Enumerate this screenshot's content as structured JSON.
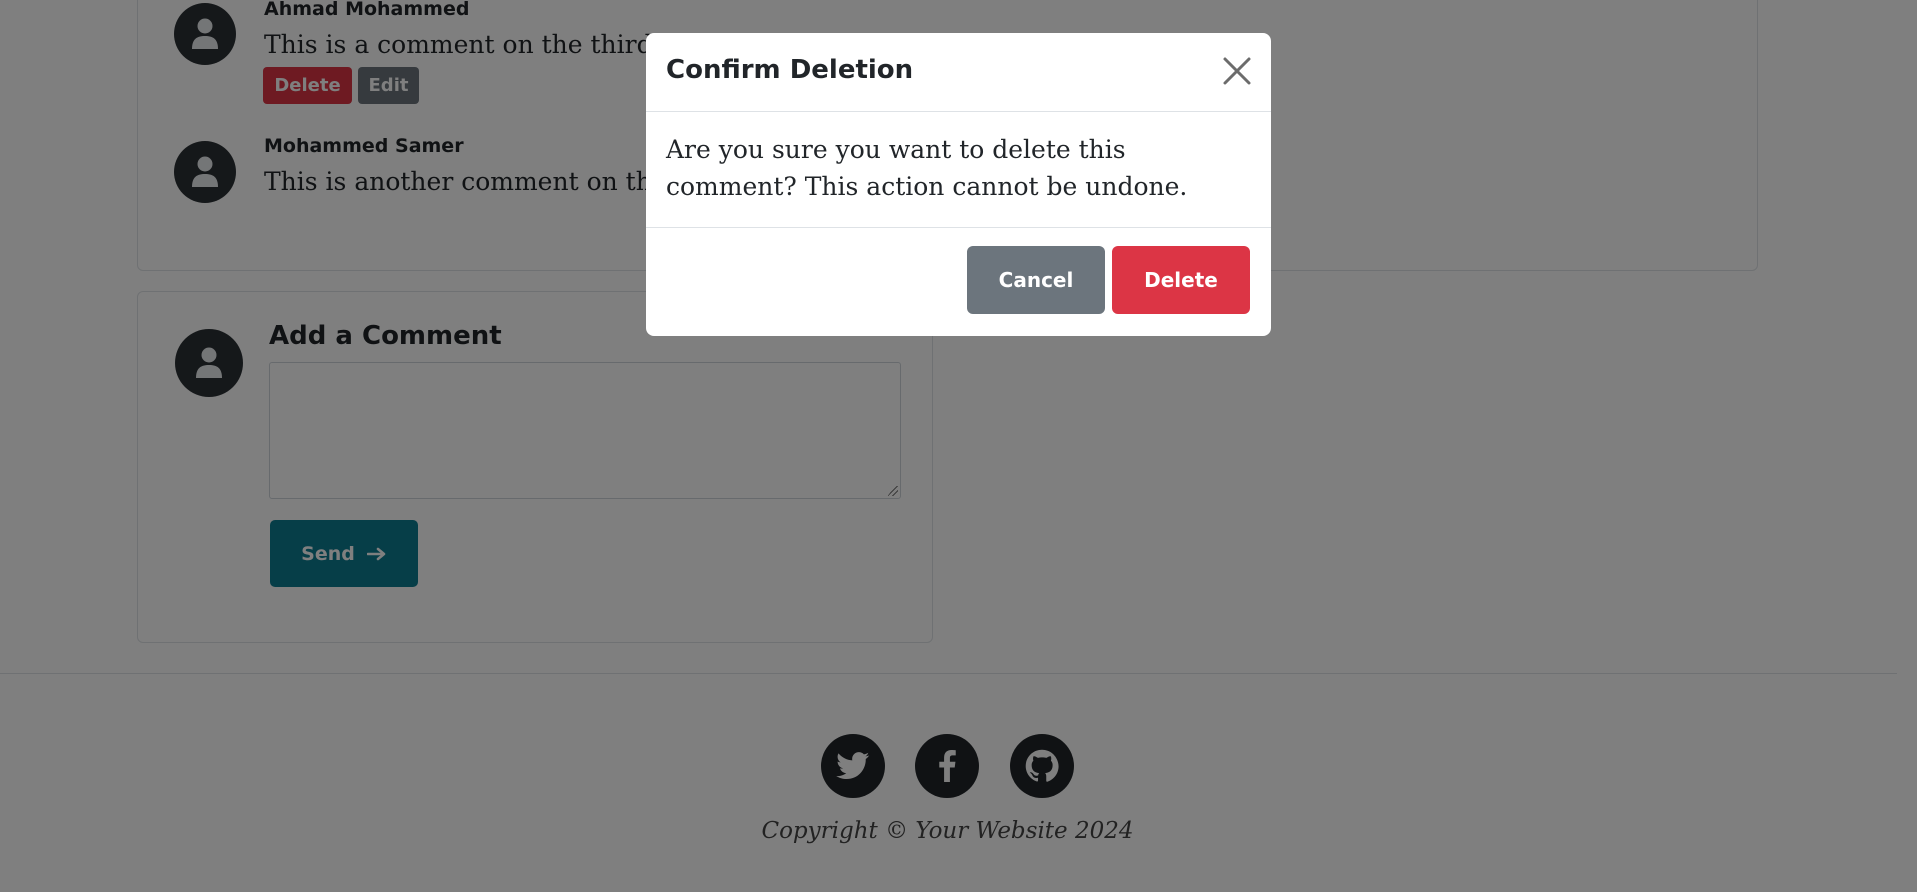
{
  "comments": [
    {
      "author": "Ahmad Mohammed",
      "text": "This is a comment on the third post.",
      "actions": {
        "delete": "Delete",
        "edit": "Edit"
      }
    },
    {
      "author": "Mohammed Samer",
      "text": "This is another comment on the third post."
    }
  ],
  "add_comment": {
    "title": "Add a Comment",
    "textarea_value": "",
    "send_label": "Send",
    "send_icon": "arrow-right-icon"
  },
  "footer": {
    "social_icons": [
      "twitter-icon",
      "facebook-icon",
      "github-icon"
    ],
    "copyright": "Copyright © Your Website 2024"
  },
  "modal": {
    "title": "Confirm Deletion",
    "body": "Are you sure you want to delete this comment? This action cannot be undone.",
    "cancel_label": "Cancel",
    "delete_label": "Delete",
    "close_icon": "close-icon"
  },
  "colors": {
    "danger": "#dc3545",
    "secondary": "#6c757d",
    "primary": "#0d7c91",
    "overlay": "rgba(0,0,0,0.5)"
  }
}
